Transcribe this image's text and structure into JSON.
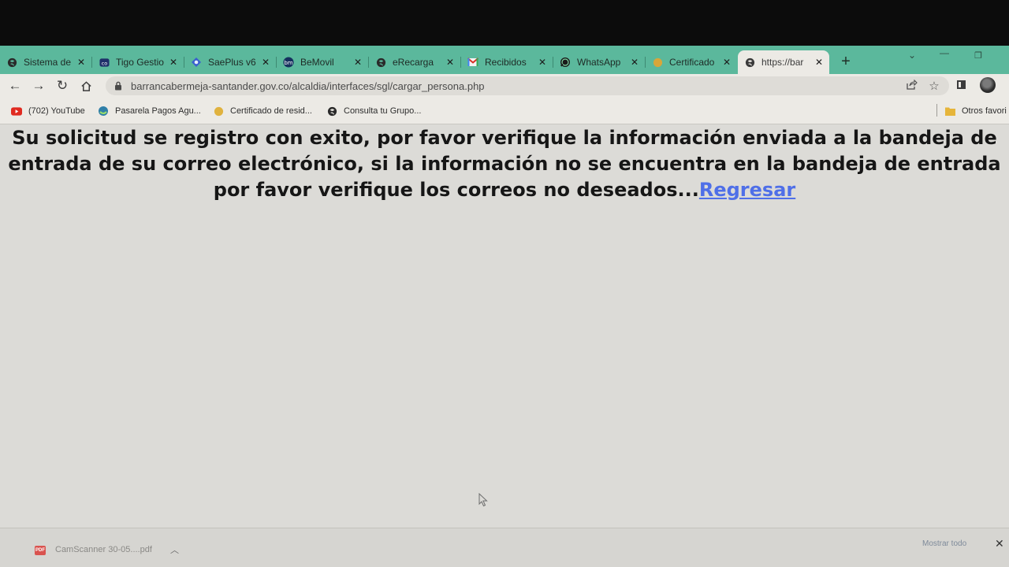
{
  "browser": {
    "tabs": [
      {
        "title": "Sistema de",
        "icon": "globe-icon",
        "active": false
      },
      {
        "title": "Tigo Gestio",
        "icon": "tigo-icon",
        "active": false
      },
      {
        "title": "SaePlus v6",
        "icon": "saeplus-icon",
        "active": false
      },
      {
        "title": "BeMovil",
        "icon": "bemovil-icon",
        "active": false
      },
      {
        "title": "eRecarga",
        "icon": "globe-icon",
        "active": false
      },
      {
        "title": "Recibidos",
        "icon": "gmail-icon",
        "active": false
      },
      {
        "title": "WhatsApp",
        "icon": "whatsapp-icon",
        "active": false
      },
      {
        "title": "Certificado",
        "icon": "certificate-icon",
        "active": false
      },
      {
        "title": "https://bar",
        "icon": "globe-icon",
        "active": true
      }
    ],
    "new_tab_label": "+",
    "address_bar": {
      "url": "barrancabermeja-santander.gov.co/alcaldia/interfaces/sgl/cargar_persona.php"
    },
    "bookmarks": [
      {
        "label": "(702) YouTube",
        "icon": "youtube-icon"
      },
      {
        "label": "Pasarela Pagos Agu...",
        "icon": "water-drop-icon"
      },
      {
        "label": "Certificado de resid...",
        "icon": "certificate-icon"
      },
      {
        "label": "Consulta tu Grupo...",
        "icon": "globe-icon"
      }
    ],
    "other_bookmarks_label": "Otros favori"
  },
  "page": {
    "message": "Su solicitud se registro con exito, por favor verifique la información enviada a la bandeja de entrada de su correo electrónico, si la información no se encuentra en la bandeja de entrada por favor verifique los correos no deseados...",
    "link_text": "Regresar"
  },
  "downloads": {
    "file_name": "CamScanner 30-05....pdf",
    "show_all_label": "Mostrar todo"
  },
  "colors": {
    "tab_strip": "#5bb89c",
    "toolbar": "#eceae5",
    "page_background": "#dcdbd7",
    "link": "#4f6fe8"
  }
}
